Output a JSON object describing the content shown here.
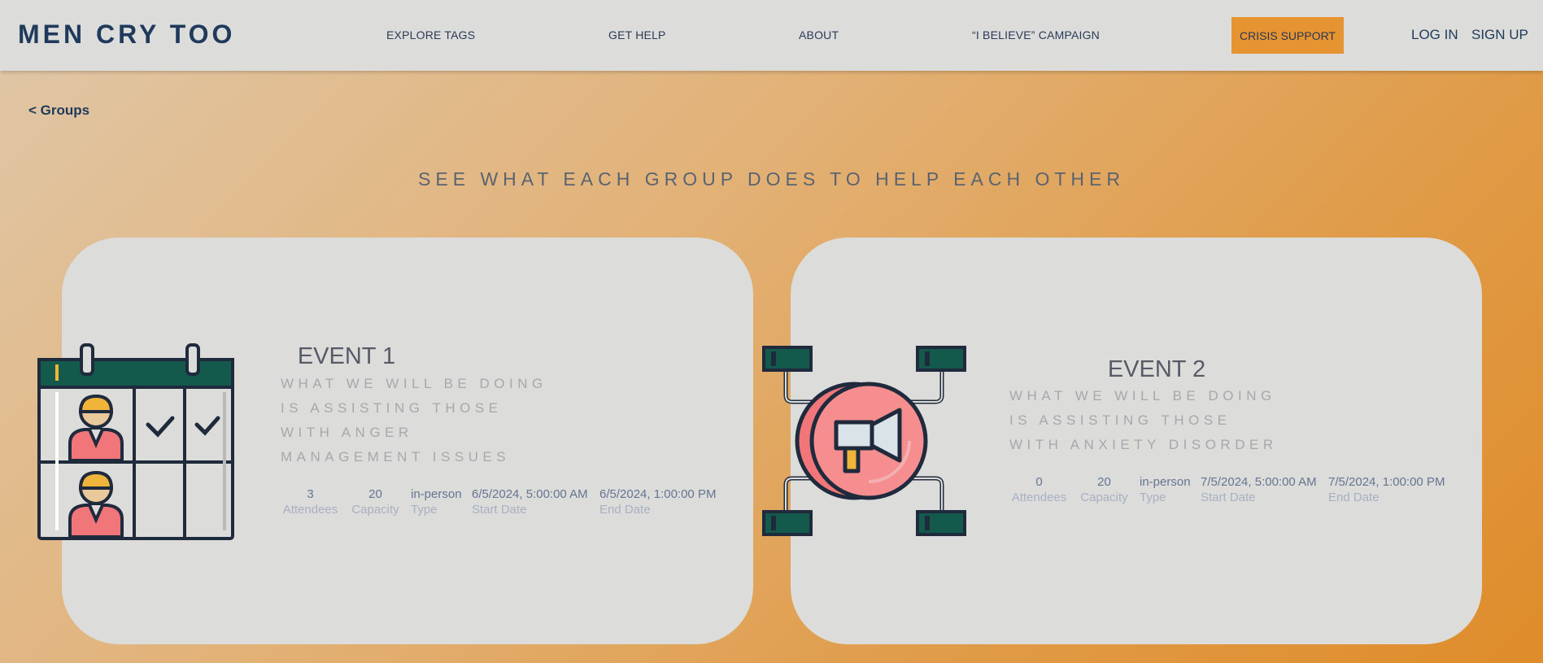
{
  "header": {
    "logo": "MEN CRY TOO",
    "nav": [
      "EXPLORE TAGS",
      "GET HELP",
      "ABOUT",
      "“I BELIEVE” CAMPAIGN"
    ],
    "crisis_label": "CRISIS SUPPORT",
    "login": "LOG IN",
    "signup": "SIGN UP"
  },
  "back_link": "< Groups",
  "page_heading": "SEE WHAT EACH GROUP DOES TO HELP EACH OTHER",
  "events": [
    {
      "title": "EVENT 1",
      "description_lines": [
        "WHAT WE WILL BE DOING",
        "IS ASSISTING THOSE",
        "WITH ANGER",
        "MANAGEMENT ISSUES"
      ],
      "icon": "calendar-schedule-icon",
      "stats": [
        {
          "value": "3",
          "label": "Attendees"
        },
        {
          "value": "20",
          "label": "Capacity"
        },
        {
          "value": "in-person",
          "label": "Type"
        },
        {
          "value": "6/5/2024, 5:00:00 AM",
          "label": "Start Date"
        },
        {
          "value": "6/5/2024, 1:00:00 PM",
          "label": "End Date"
        }
      ]
    },
    {
      "title": "EVENT 2",
      "description_lines": [
        "WHAT WE WILL BE DOING",
        "IS ASSISTING THOSE",
        "WITH ANXIETY DISORDER"
      ],
      "icon": "megaphone-network-icon",
      "stats": [
        {
          "value": "0",
          "label": "Attendees"
        },
        {
          "value": "20",
          "label": "Capacity"
        },
        {
          "value": "in-person",
          "label": "Type"
        },
        {
          "value": "7/5/2024, 5:00:00 AM",
          "label": "Start Date"
        },
        {
          "value": "7/5/2024, 1:00:00 PM",
          "label": "End Date"
        }
      ]
    }
  ],
  "colors": {
    "header_bg": "#dcdcdb",
    "brand_navy": "#1f3a5a",
    "crisis_orange": "#e69432",
    "card_bg": "#dcdcdb",
    "illus_green": "#145a4c",
    "illus_red": "#f0767a",
    "illus_yellow": "#f0b43a"
  }
}
